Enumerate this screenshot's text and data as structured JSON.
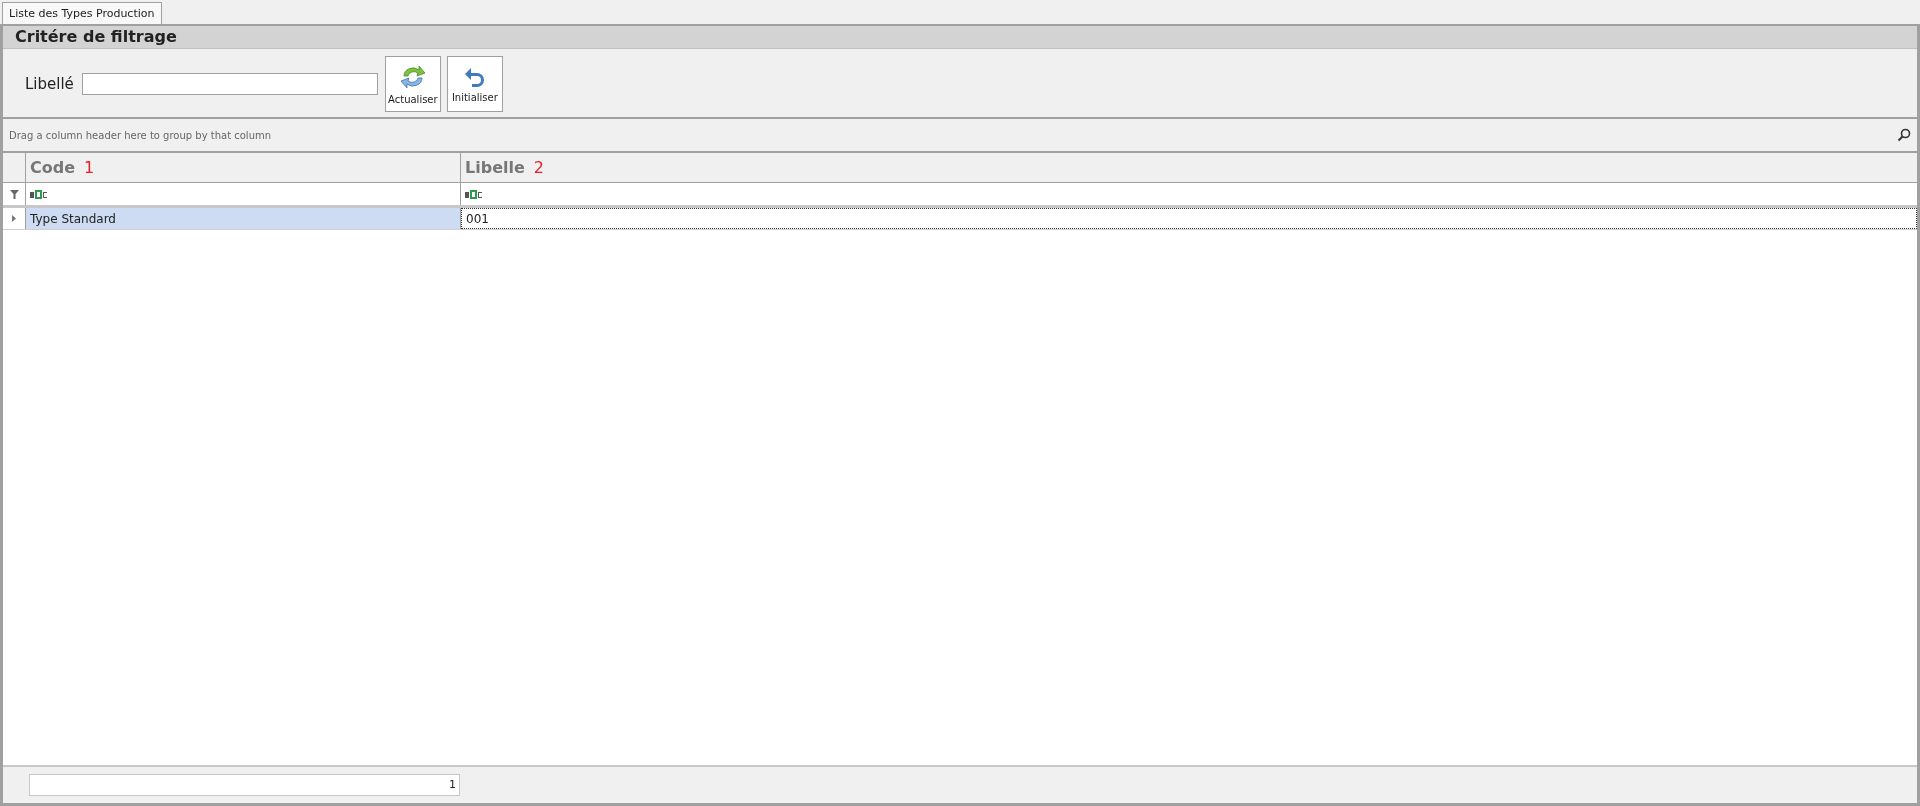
{
  "tabs": [
    {
      "label": "Liste des Types Production",
      "selected": true
    }
  ],
  "filter_panel": {
    "title": "Critére de filtrage",
    "fields": [
      {
        "label": "Libellé"
      }
    ],
    "buttons": [
      {
        "label": "Actualiser",
        "kind": "refresh"
      },
      {
        "label": "Initialiser",
        "kind": "reset"
      }
    ]
  },
  "grid": {
    "group_panel": "Drag a column header here to group by that column",
    "columns": [
      {
        "label": "Code",
        "marker": "1"
      },
      {
        "label": "Libelle",
        "marker": "2"
      }
    ],
    "rows": [
      {
        "cells": [
          "Type Standard",
          "001"
        ],
        "selected": true
      }
    ],
    "footer": {
      "summary": "1"
    }
  }
}
